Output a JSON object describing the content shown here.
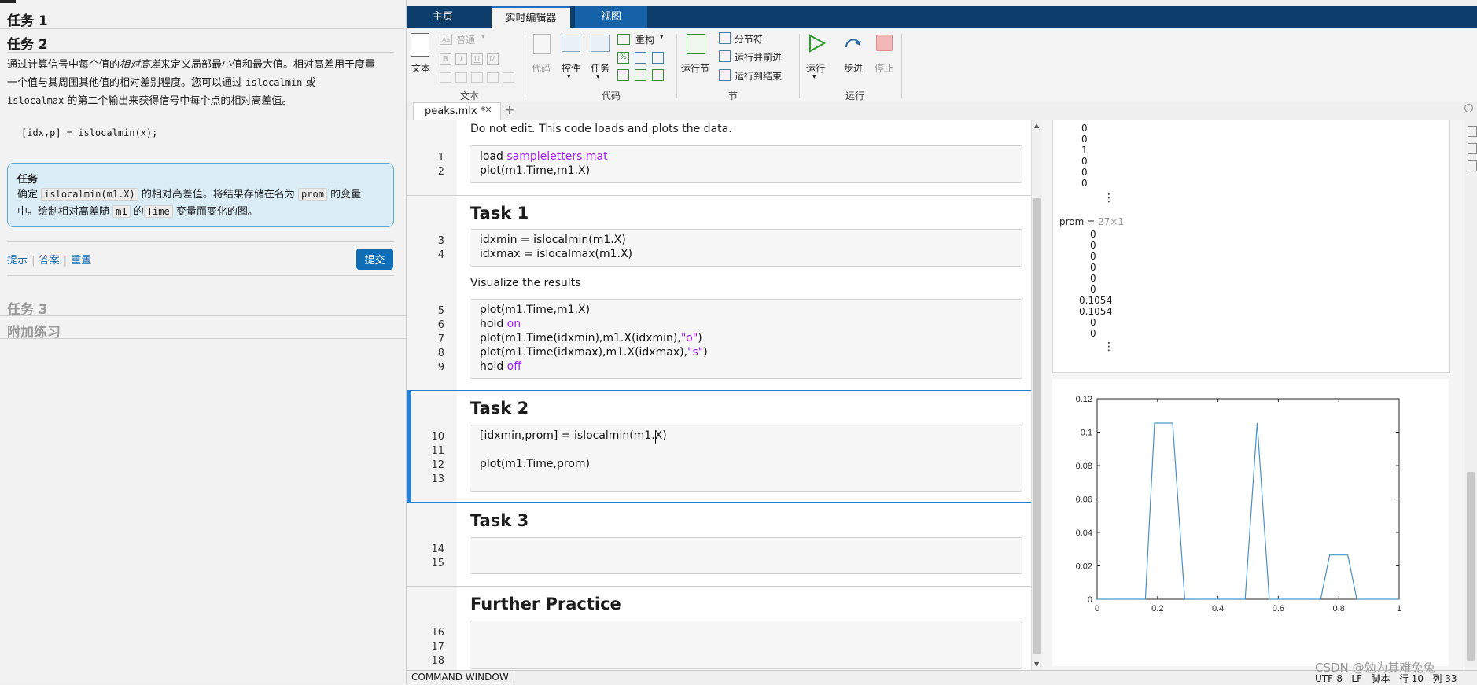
{
  "left": {
    "task1_title": "任务 1",
    "task2_title": "任务 2",
    "desc_p1": "通过计算信号中每个值的",
    "desc_em": "相对高差",
    "desc_p2": "来定义局部最小值和最大值。相对高差用于度量",
    "desc_l2_a": "一个值与其周围其他值的相对差别程度。您可以通过",
    "desc_l2_code": "islocalmin",
    "desc_l2_b": "或",
    "desc_l3_code": "islocalmax",
    "desc_l3_b": "的第二个输出来获得信号中每个点的相对高差值。",
    "code_example": "[idx,p] = islocalmin(x);",
    "box_title": "任务",
    "box_l1_a": "确定",
    "box_l1_code": "islocalmin(m1.X)",
    "box_l1_b": "的相对高差值。将结果存储在名为",
    "box_l1_code2": "prom",
    "box_l1_c": "的变量",
    "box_l2_a": "中。绘制相对高差随",
    "box_l2_code": "m1",
    "box_l2_b": "的",
    "box_l2_code2": "Time",
    "box_l2_c": "变量而变化的图。",
    "hint": "提示",
    "answer": "答案",
    "reset": "重置",
    "submit": "提交",
    "task3_title": "任务 3",
    "extra_title": "附加练习"
  },
  "ribbon": {
    "tabs": [
      "主页",
      "实时编辑器",
      "视图"
    ],
    "text_btn": "文本",
    "style_sel": "普通",
    "text_group": "文本",
    "code_btn": "代码",
    "control_btn": "控件",
    "task_btn": "任务",
    "refactor_btn": "重构",
    "code_group": "代码",
    "run_section": "运行节",
    "section_break": "分节符",
    "run_advance": "运行并前进",
    "run_to_end": "运行到结束",
    "section_group": "节",
    "run_btn": "运行",
    "step_btn": "步进",
    "stop_btn": "停止",
    "run_group": "运行"
  },
  "editor": {
    "file_tab": "peaks.mlx *",
    "intro_text": "Do not edit. This code loads and plots the data.",
    "line1_a": "load ",
    "line1_b": "sampleletters.mat",
    "line2": "plot(m1.Time,m1.X)",
    "task1": "Task 1",
    "line3": "idxmin = islocalmin(m1.X)",
    "line4": "idxmax = islocalmax(m1.X)",
    "visualize": "Visualize the results",
    "line5": "plot(m1.Time,m1.X)",
    "line6_a": "hold ",
    "line6_b": "on",
    "line7_a": "plot(m1.Time(idxmin),m1.X(idxmin),",
    "line7_b": "\"o\"",
    "line7_c": ")",
    "line8_a": "plot(m1.Time(idxmax),m1.X(idxmax),",
    "line8_b": "\"s\"",
    "line8_c": ")",
    "line9_a": "hold ",
    "line9_b": "off",
    "task2": "Task 2",
    "line10": "[idxmin,prom] = islocalmin(m1.X)",
    "line12": "plot(m1.Time,prom)",
    "task3": "Task 3",
    "further": "Further Practice",
    "line_numbers": [
      "1",
      "2",
      "3",
      "4",
      "5",
      "6",
      "7",
      "8",
      "9",
      "10",
      "11",
      "12",
      "13",
      "14",
      "15",
      "16",
      "17",
      "18"
    ]
  },
  "output": {
    "top_values": [
      "0",
      "0",
      "1",
      "0",
      "0",
      "0"
    ],
    "ellipsis": "⋮",
    "prom_label": "prom = ",
    "prom_size": "27×1",
    "prom_values": [
      "0",
      "0",
      "0",
      "0",
      "0",
      "0",
      "0.1054",
      "0.1054",
      "0",
      "0"
    ]
  },
  "chart_data": {
    "type": "line",
    "x": [
      0,
      0.16,
      0.19,
      0.25,
      0.29,
      0.32,
      0.49,
      0.53,
      0.57,
      0.74,
      0.77,
      0.83,
      0.86,
      1.0
    ],
    "y": [
      0,
      0,
      0.1054,
      0.1054,
      0,
      0,
      0,
      0.1054,
      0,
      0,
      0.0265,
      0.0265,
      0,
      0
    ],
    "xlim": [
      0,
      1
    ],
    "ylim": [
      0,
      0.12
    ],
    "xticks": [
      "0",
      "0.2",
      "0.4",
      "0.6",
      "0.8",
      "1"
    ],
    "yticks": [
      "0",
      "0.02",
      "0.04",
      "0.06",
      "0.08",
      "0.1",
      "0.12"
    ],
    "color": "#4a90c8",
    "title": "",
    "xlabel": "",
    "ylabel": ""
  },
  "status": {
    "command_window": "COMMAND WINDOW",
    "right": "UTF-8   LF   脚本   行 10   列 33"
  },
  "watermark": "CSDN @勉为其难免兔"
}
